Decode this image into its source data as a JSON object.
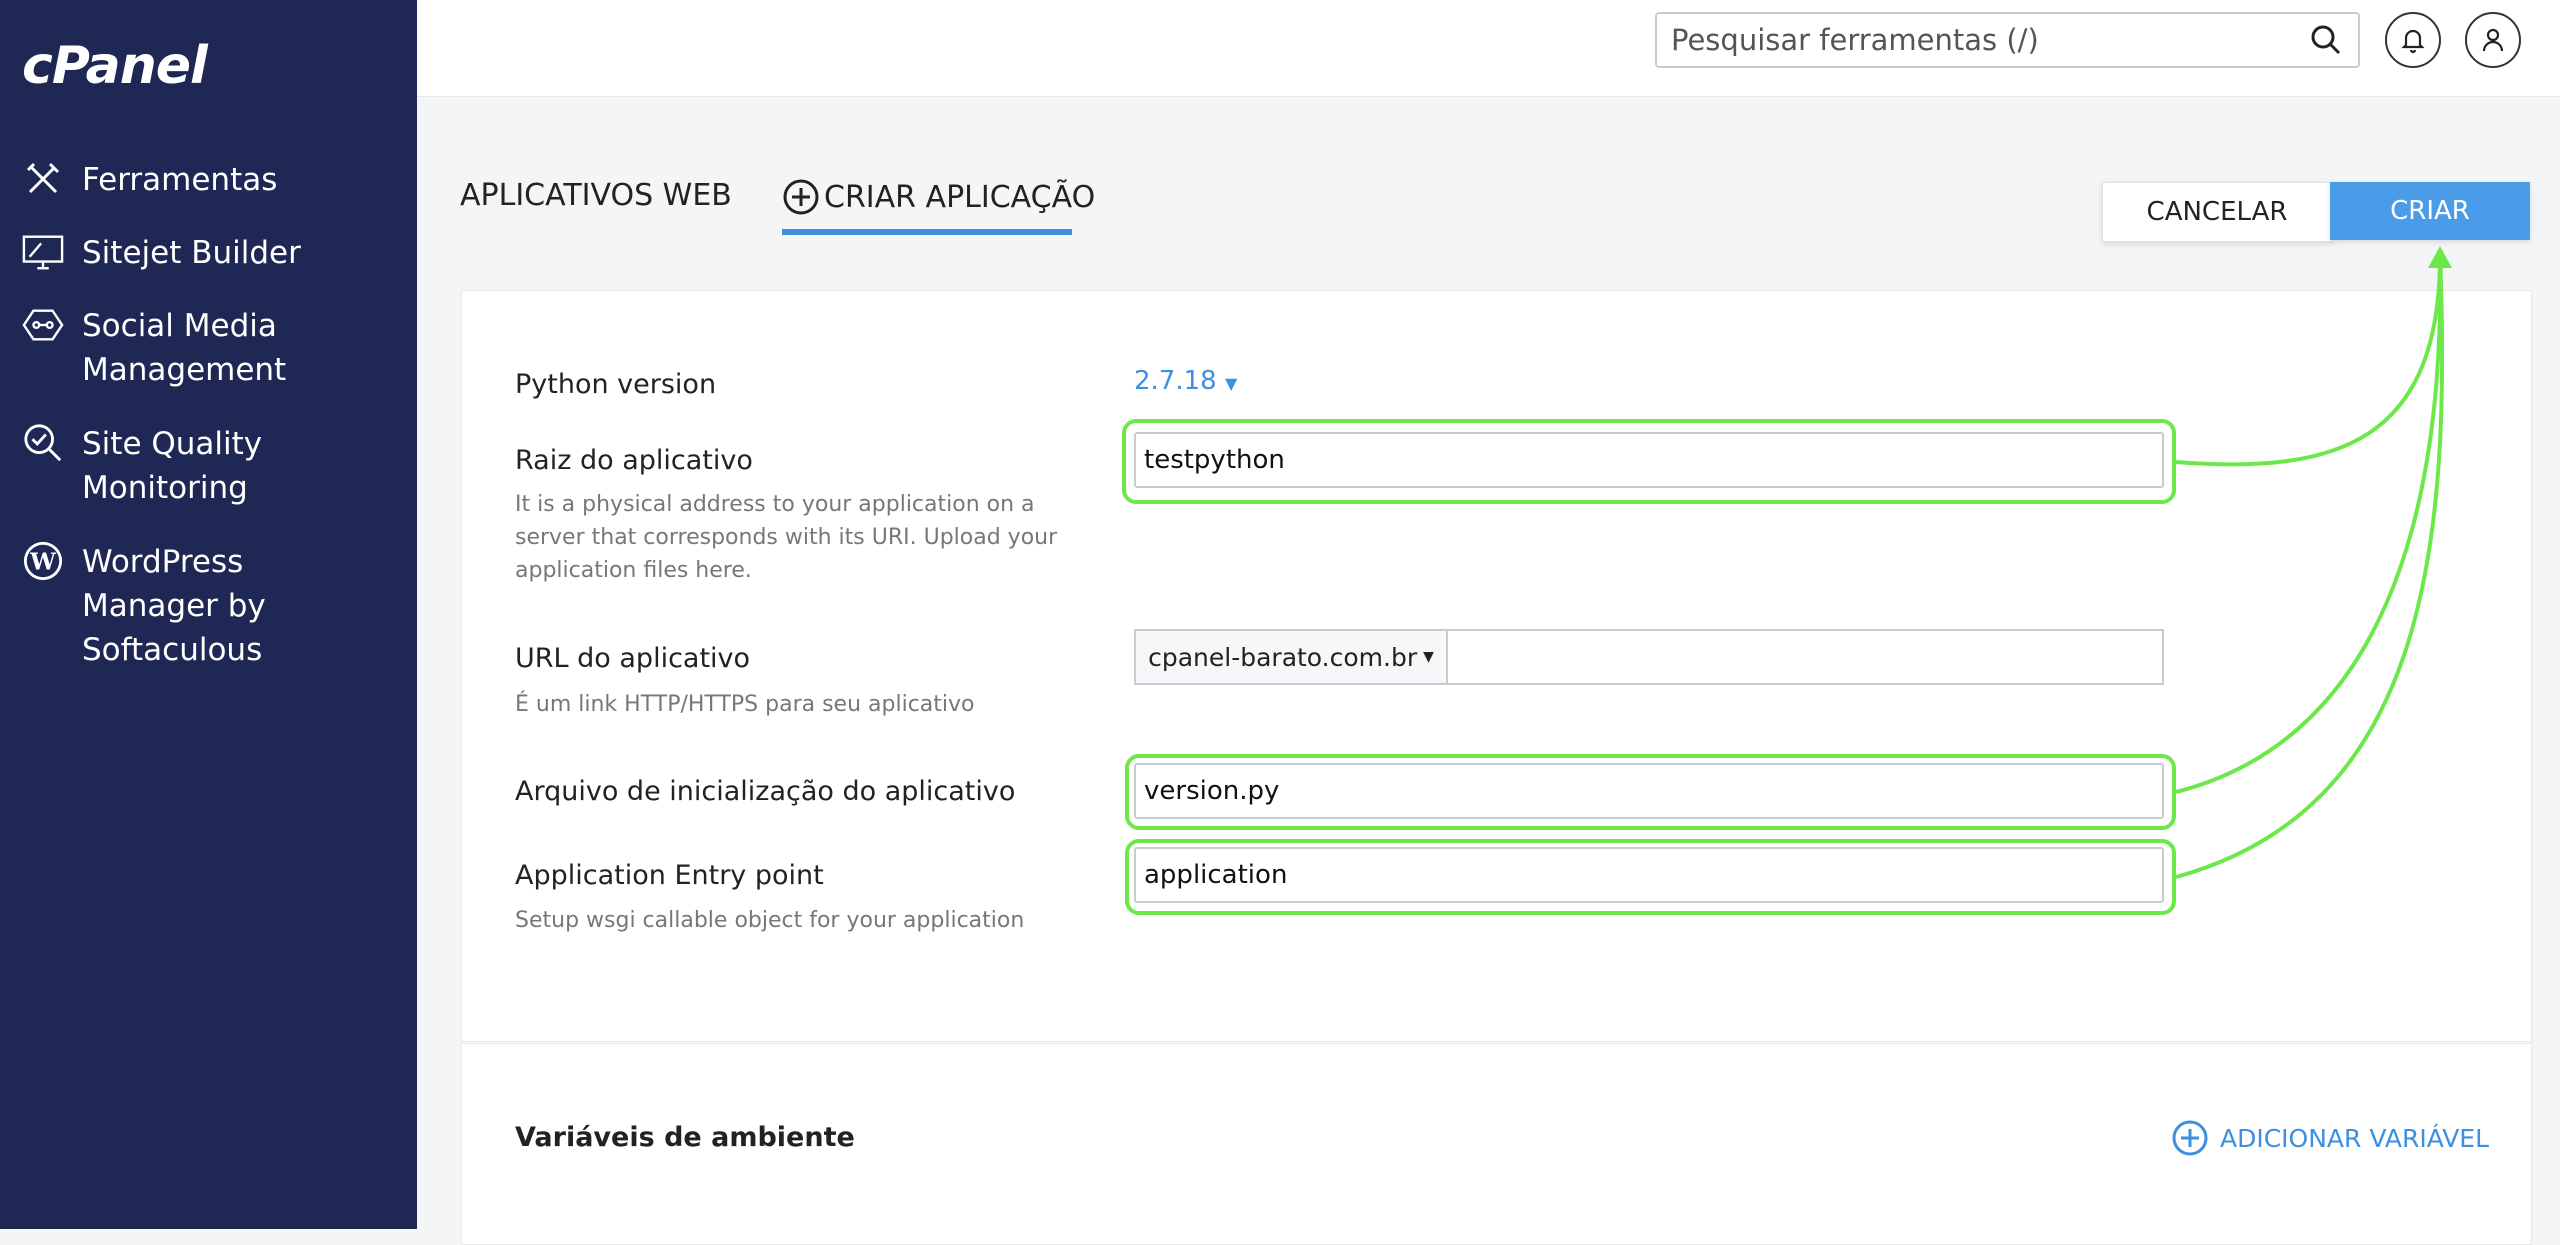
{
  "sidebar": {
    "logo": "cPanel",
    "items": [
      {
        "label": "Ferramentas",
        "icon": "tools-icon"
      },
      {
        "label": "Sitejet Builder",
        "icon": "monitor-icon"
      },
      {
        "label": "Social Media Management",
        "icon": "social-icon"
      },
      {
        "label": "Site Quality Monitoring",
        "icon": "magnifier-check-icon"
      },
      {
        "label": "WordPress Manager by Softaculous",
        "icon": "wordpress-icon"
      }
    ]
  },
  "header": {
    "search_placeholder": "Pesquisar ferramentas (/)"
  },
  "tabs": {
    "web_apps": "APLICATIVOS WEB",
    "create_app": "CRIAR APLICAÇÃO"
  },
  "actions": {
    "cancel": "CANCELAR",
    "create": "CRIAR"
  },
  "form": {
    "python_version_label": "Python version",
    "python_version_value": "2.7.18",
    "app_root_label": "Raiz do aplicativo",
    "app_root_help": "It is a physical address to your application on a server that corresponds with its URI. Upload your application files here.",
    "app_root_value": "testpython",
    "app_url_label": "URL do aplicativo",
    "app_url_help": "É um link HTTP/HTTPS para seu aplicativo",
    "app_url_domain": "cpanel-barato.com.br",
    "app_url_path": "",
    "startup_file_label": "Arquivo de inicialização do aplicativo",
    "startup_file_value": "version.py",
    "entry_point_label": "Application Entry point",
    "entry_point_help": "Setup wsgi callable object for your application",
    "entry_point_value": "application"
  },
  "env": {
    "title": "Variáveis de ambiente",
    "add_label": "ADICIONAR VARIÁVEL"
  },
  "colors": {
    "sidebar_bg": "#1f2754",
    "accent": "#4a9be8",
    "highlight": "#6ce84a"
  }
}
